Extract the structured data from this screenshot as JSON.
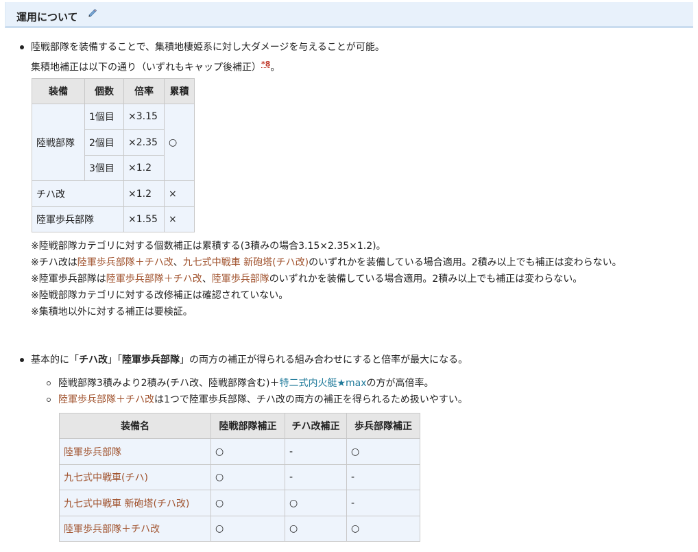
{
  "section": {
    "title": "運用について"
  },
  "intro": {
    "line1": "陸戦部隊を装備することで、集積地棲姫系に対し大ダメージを与えることが可能。",
    "line2_prefix": "集積地補正は以下の通り（いずれもキャップ後補正）",
    "footnote": "*8",
    "line2_suffix": "。"
  },
  "table1": {
    "headers": [
      "装備",
      "個数",
      "倍率",
      "累積"
    ],
    "group_label": "陸戦部隊",
    "group_rows": [
      {
        "count": "1個目",
        "rate": "×3.15"
      },
      {
        "count": "2個目",
        "rate": "×2.35"
      },
      {
        "count": "3個目",
        "rate": "×1.2"
      }
    ],
    "group_cumulative": "○",
    "rows": [
      {
        "name": "チハ改",
        "rate": "×1.2",
        "cumulative": "×"
      },
      {
        "name": "陸軍歩兵部隊",
        "rate": "×1.55",
        "cumulative": "×"
      }
    ]
  },
  "notes": {
    "n1": "※陸戦部隊カテゴリに対する個数補正は累積する(3積みの場合3.15×2.35×1.2)。",
    "n2_a": "※チハ改は",
    "n2_link1": "陸軍歩兵部隊＋チハ改",
    "n2_b": "、",
    "n2_link2": "九七式中戦車 新砲塔(チハ改)",
    "n2_c": "のいずれかを装備している場合適用。2積み以上でも補正は変わらない。",
    "n3_a": "※陸軍歩兵部隊は",
    "n3_link1": "陸軍歩兵部隊＋チハ改",
    "n3_b": "、",
    "n3_link2": "陸軍歩兵部隊",
    "n3_c": "のいずれかを装備している場合適用。2積み以上でも補正は変わらない。",
    "n4": "※陸戦部隊カテゴリに対する改修補正は確認されていない。",
    "n5": "※集積地以外に対する補正は要検証。"
  },
  "bullet2": {
    "a": "基本的に「",
    "b1": "チハ改",
    "c": "」「",
    "b2": "陸軍歩兵部隊",
    "d": "」の両方の補正が得られる組み合わせにすると倍率が最大になる。"
  },
  "sub": {
    "s1_a": "陸戦部隊3積みより2積み(チハ改、陸戦部隊含む)＋",
    "s1_link": "特二式内火艇★max",
    "s1_b": "の方が高倍率。",
    "s2_link": "陸軍歩兵部隊＋チハ改",
    "s2_b": "は1つで陸軍歩兵部隊、チハ改の両方の補正を得られるため扱いやすい。"
  },
  "table2": {
    "headers": [
      "装備名",
      "陸戦部隊補正",
      "チハ改補正",
      "歩兵部隊補正"
    ],
    "rows": [
      {
        "name": "陸軍歩兵部隊",
        "a": "○",
        "b": "-",
        "c": "○"
      },
      {
        "name": "九七式中戦車(チハ)",
        "a": "○",
        "b": "-",
        "c": "-"
      },
      {
        "name": "九七式中戦車 新砲塔(チハ改)",
        "a": "○",
        "b": "○",
        "c": "-"
      },
      {
        "name": "陸軍歩兵部隊＋チハ改",
        "a": "○",
        "b": "○",
        "c": "○"
      }
    ]
  },
  "colors": {
    "link": "#a0522d",
    "link_blue": "#1f7a9a",
    "header_bg": "#e8f1fb",
    "table_head": "#e6e6e6",
    "table_cell": "#eef4fc"
  }
}
